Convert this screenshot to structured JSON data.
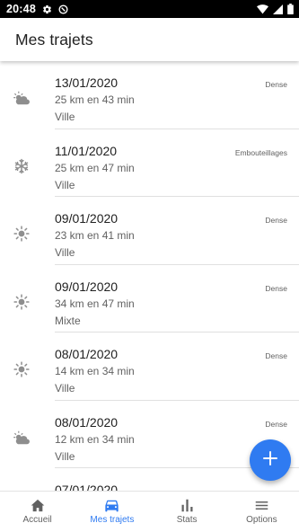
{
  "status_bar": {
    "time": "20:48"
  },
  "app_bar": {
    "title": "Mes trajets"
  },
  "trips": [
    {
      "date": "13/01/2020",
      "distance": "25 km en 43 min",
      "type": "Ville",
      "traffic": "Dense",
      "weather_icon": "partly-cloudy-icon"
    },
    {
      "date": "11/01/2020",
      "distance": "25 km en 47 min",
      "type": "Ville",
      "traffic": "Embouteillages",
      "weather_icon": "snowflake-icon"
    },
    {
      "date": "09/01/2020",
      "distance": "23 km en 41 min",
      "type": "Ville",
      "traffic": "Dense",
      "weather_icon": "sun-icon"
    },
    {
      "date": "09/01/2020",
      "distance": "34 km en 47 min",
      "type": "Mixte",
      "traffic": "Dense",
      "weather_icon": "sun-icon"
    },
    {
      "date": "08/01/2020",
      "distance": "14 km en 34 min",
      "type": "Ville",
      "traffic": "Dense",
      "weather_icon": "sun-icon"
    },
    {
      "date": "08/01/2020",
      "distance": "12 km en 34 min",
      "type": "Ville",
      "traffic": "Dense",
      "weather_icon": "partly-cloudy-icon"
    },
    {
      "date": "07/01/2020",
      "distance": "",
      "type": "",
      "traffic": "",
      "weather_icon": ""
    }
  ],
  "fab": {
    "icon": "plus-icon"
  },
  "bottom_nav": [
    {
      "label": "Accueil",
      "icon": "home-icon",
      "active": false
    },
    {
      "label": "Mes trajets",
      "icon": "car-icon",
      "active": true
    },
    {
      "label": "Stats",
      "icon": "bar-chart-icon",
      "active": false
    },
    {
      "label": "Options",
      "icon": "menu-icon",
      "active": false
    }
  ],
  "colors": {
    "accent": "#2f7bf1",
    "icon_gray": "#8e8e8e",
    "text_secondary": "#616161"
  }
}
